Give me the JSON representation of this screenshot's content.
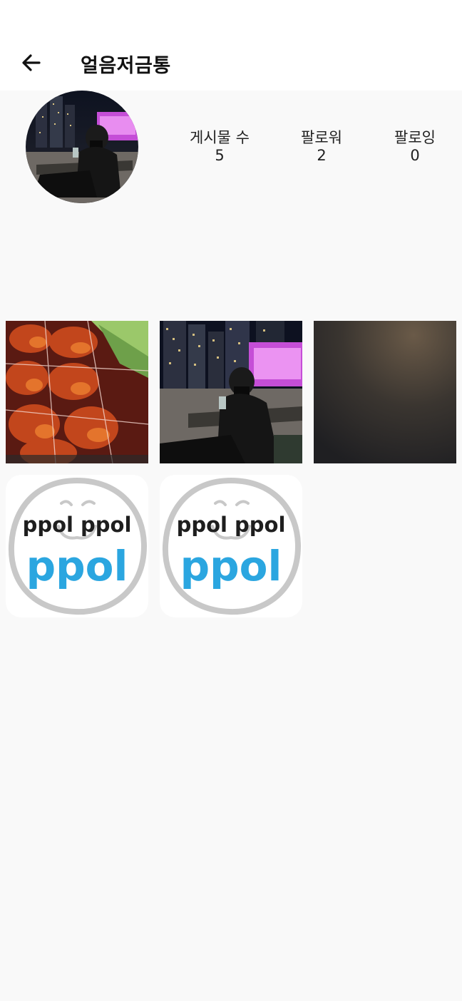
{
  "header": {
    "title": "얼음저금통",
    "back_icon": "arrow-left-icon"
  },
  "profile": {
    "stats": [
      {
        "label": "게시물 수",
        "value": "5"
      },
      {
        "label": "팔로워",
        "value": "2"
      },
      {
        "label": "팔로잉",
        "value": "0"
      }
    ]
  },
  "posts": [
    {
      "kind": "photo-food"
    },
    {
      "kind": "photo-night-person"
    },
    {
      "kind": "photo-dark-surface"
    },
    {
      "kind": "logo",
      "line1": "ppol ppol",
      "line2": "ppol"
    },
    {
      "kind": "logo",
      "line1": "ppol ppol",
      "line2": "ppol"
    }
  ],
  "colors": {
    "appbar": "#ffffff",
    "background": "#f9f9f9",
    "logo_blue": "#2ba6e0",
    "logo_dark": "#1e1e1e",
    "logo_ring": "#c8c8c8"
  }
}
